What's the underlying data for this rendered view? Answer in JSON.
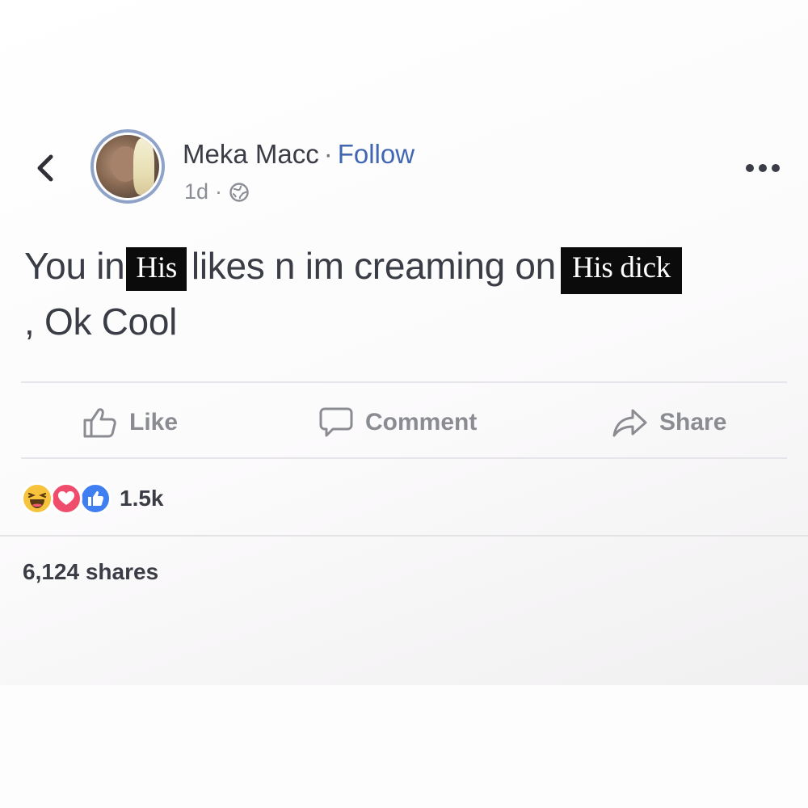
{
  "header": {
    "author": "Meka Macc",
    "separator": "·",
    "follow": "Follow",
    "time": "1d",
    "meta_separator": "·",
    "back_icon": "chevron-left-icon",
    "privacy_icon": "globe-icon",
    "more_icon": "more-dots-icon"
  },
  "post": {
    "text_1": "You in",
    "redacted_1": "His",
    "text_2": "likes n im creaming on",
    "redacted_2": "His dick",
    "text_3": ", Ok Cool"
  },
  "actions": {
    "like": "Like",
    "comment": "Comment",
    "share": "Share"
  },
  "reactions": {
    "icons": [
      "haha-icon",
      "love-icon",
      "like-icon"
    ],
    "count": "1.5k"
  },
  "shares": "6,124 shares",
  "colors": {
    "text": "#3a3d45",
    "follow": "#4267b2",
    "muted": "#8a8c92",
    "avatar_ring": "#8fa3c9",
    "redaction_box": "#0b0b0b",
    "haha": "#f7c33c",
    "love": "#ef4d6b",
    "like": "#3f7ff2"
  }
}
